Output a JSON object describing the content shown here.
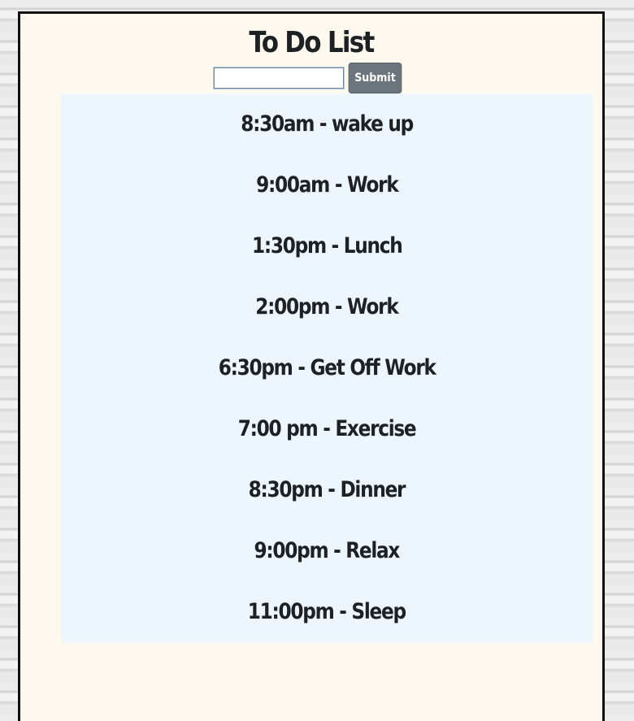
{
  "page": {
    "title": "To Do List"
  },
  "form": {
    "input_value": "",
    "input_placeholder": "",
    "submit_label": "Submit"
  },
  "tasks": [
    "8:30am - wake up",
    "9:00am - Work",
    "1:30pm - Lunch",
    "2:00pm - Work",
    "6:30pm - Get Off Work",
    "7:00 pm - Exercise",
    "8:30pm - Dinner",
    "9:00pm - Relax",
    "11:00pm - Sleep"
  ],
  "colors": {
    "page_background": "#e6e6e6",
    "card_background": "#fdf9ef",
    "list_background": "#edf6fd",
    "text": "#1e2124",
    "button": "#6c757d"
  }
}
